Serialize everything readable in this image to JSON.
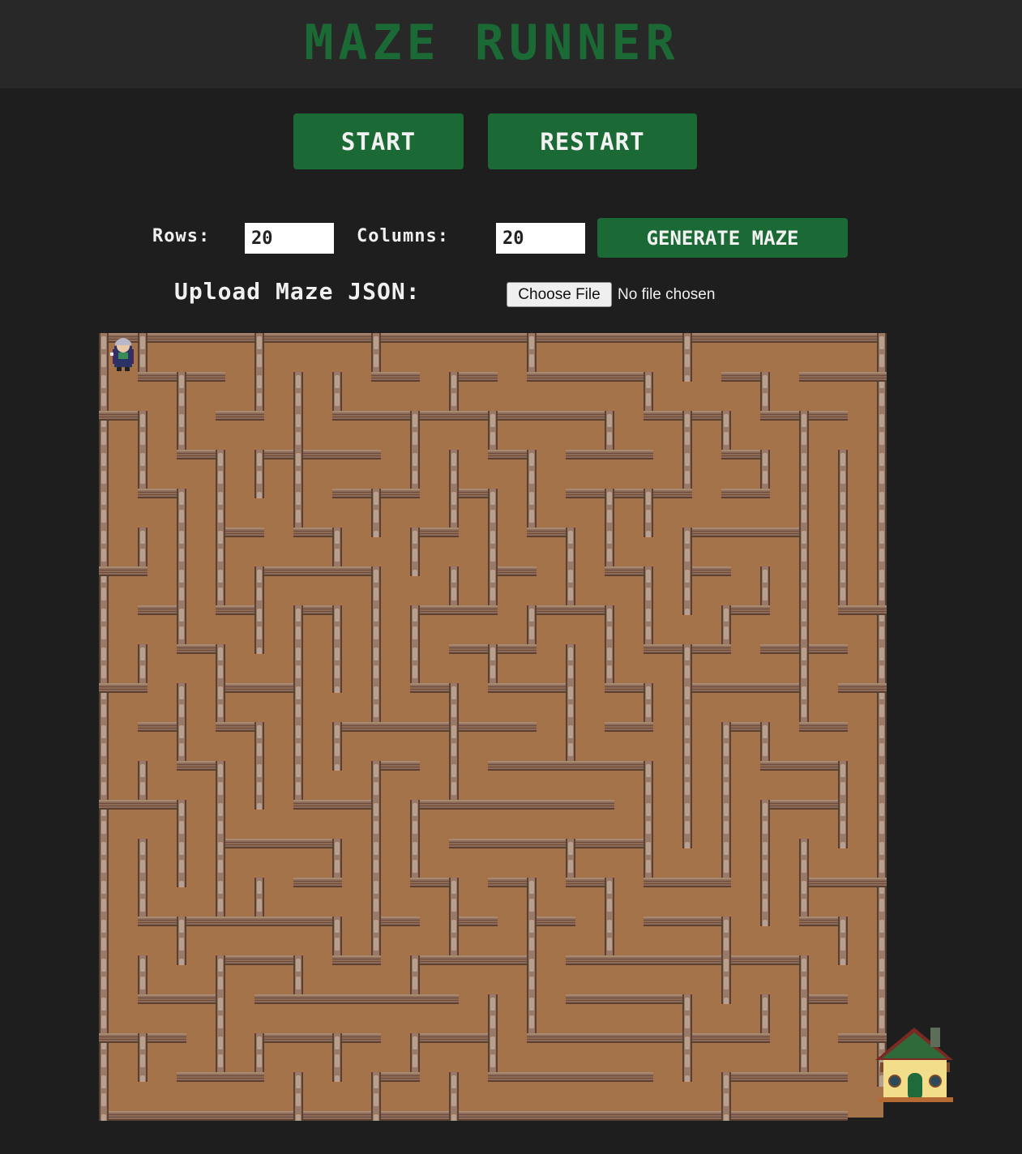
{
  "header": {
    "title": "MAZE RUNNER"
  },
  "controls": {
    "start_label": "START",
    "restart_label": "RESTART"
  },
  "config": {
    "rows_label": "Rows:",
    "rows_value": "20",
    "columns_label": "Columns:",
    "columns_value": "20",
    "generate_label": "GENERATE MAZE"
  },
  "upload": {
    "label": "Upload Maze JSON:",
    "button_label": "Choose File",
    "status": "No file chosen"
  },
  "maze": {
    "rows": 20,
    "columns": 20,
    "player_icon": "wizard-player-icon",
    "goal_icon": "cottage-goal-icon"
  },
  "colors": {
    "accent": "#1b6a36",
    "floor": "#a5734a",
    "wall": "#8a6a58",
    "background": "#1e1e1e",
    "header": "#282828"
  }
}
